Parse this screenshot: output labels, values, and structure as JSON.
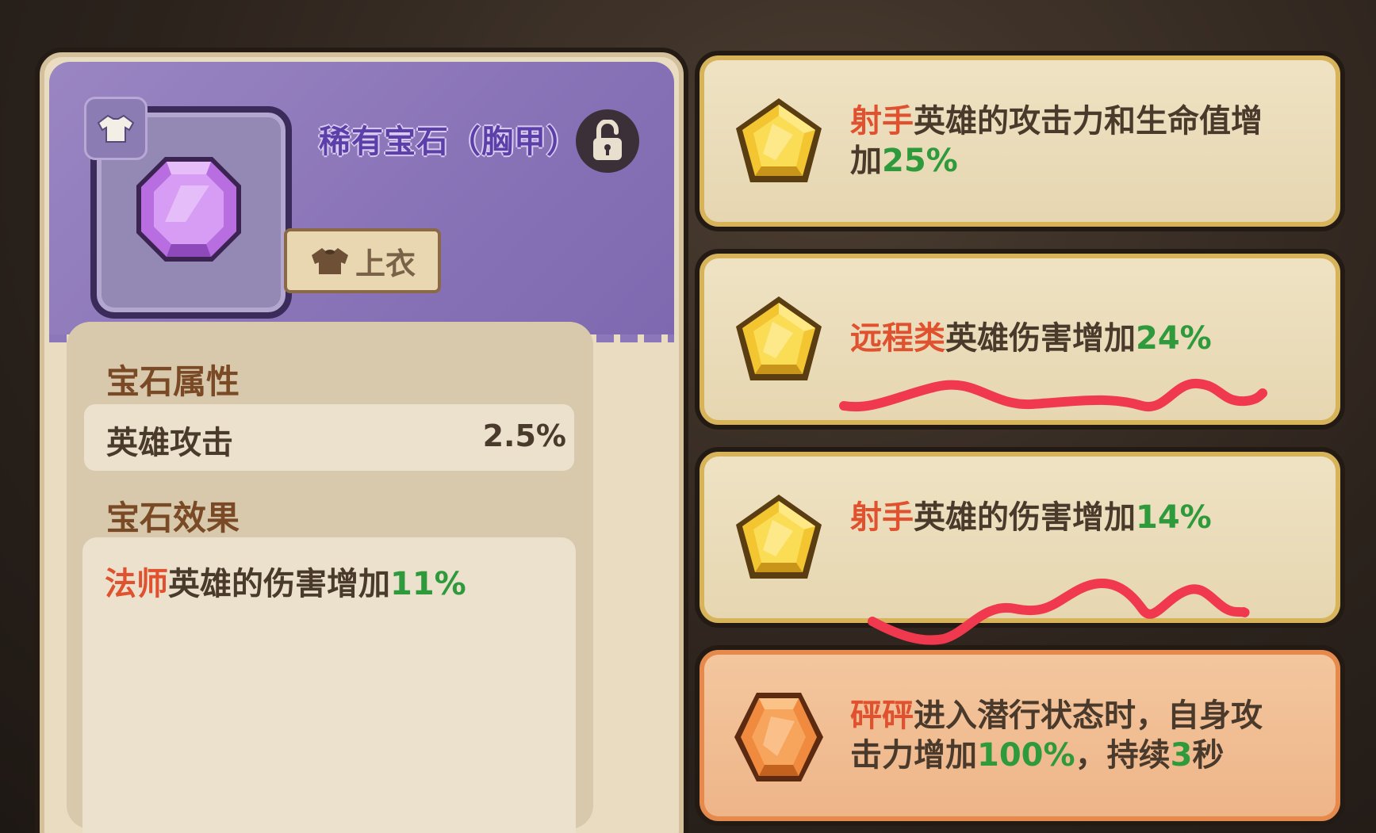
{
  "gem_panel": {
    "title": "稀有宝石（胸甲）",
    "slot_tag": "上衣",
    "slot_badge_icon": "shirt-icon",
    "lock_icon": "unlocked-padlock-icon",
    "gem_color": "#b86ee0",
    "attributes_title": "宝石属性",
    "attribute": {
      "name": "英雄攻击",
      "value": "2.5%"
    },
    "effects_title": "宝石效果",
    "effect": {
      "highlight": "法师",
      "text": "英雄的伤害增加",
      "value": "11%"
    }
  },
  "effect_cards": [
    {
      "gem_color": "#f2c531",
      "line1_highlight": "射手",
      "line1_text": "英雄的攻击力和生命值增",
      "line2_text": "加",
      "line2_value": "25%"
    },
    {
      "gem_color": "#f2c531",
      "highlight": "远程类",
      "text": "英雄伤害增加",
      "value": "24%"
    },
    {
      "gem_color": "#f2c531",
      "highlight": "射手",
      "text": "英雄的伤害增加",
      "value": "14%"
    },
    {
      "gem_color": "#ef8a3e",
      "line1_highlight": "砰砰",
      "line1_text": "进入潜行状态时，自身攻",
      "line2_text_a": "击力增加",
      "line2_value_a": "100%",
      "line2_text_b": "，持续",
      "line2_value_b": "3",
      "line2_text_c": "秒"
    }
  ],
  "colors": {
    "highlight_red": "#e0522f",
    "value_green": "#2f9a3c",
    "title_purple": "#5c3fa8",
    "scribble": "#f0394f"
  }
}
